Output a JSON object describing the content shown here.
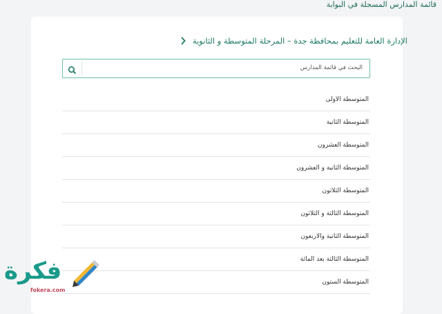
{
  "page": {
    "title": "قائمة المدارس المسجلة في البوابة"
  },
  "breadcrumb": {
    "text": "الإدارة العامة للتعليم بمحافظة جدة – المرحلة المتوسطة و الثانوية"
  },
  "search": {
    "placeholder": "البحث في قائمة المدارس"
  },
  "schools": [
    "المتوسطة الاولى",
    "المتوسطة الثانية",
    "المتوسطة العشرون",
    "المتوسطة الثانية و العشرون",
    "المتوسطة الثلاثون",
    "المتوسطة الثالثة و الثلاثون",
    "المتوسطة الثانية والاربعون",
    "المتوسطة الثالثة بعد المائة",
    "المتوسطة الستون"
  ],
  "watermark": {
    "brand": "فكرة",
    "domain": "fokera.com"
  },
  "colors": {
    "accent": "#1d7a63",
    "border": "#6bbfa8"
  }
}
